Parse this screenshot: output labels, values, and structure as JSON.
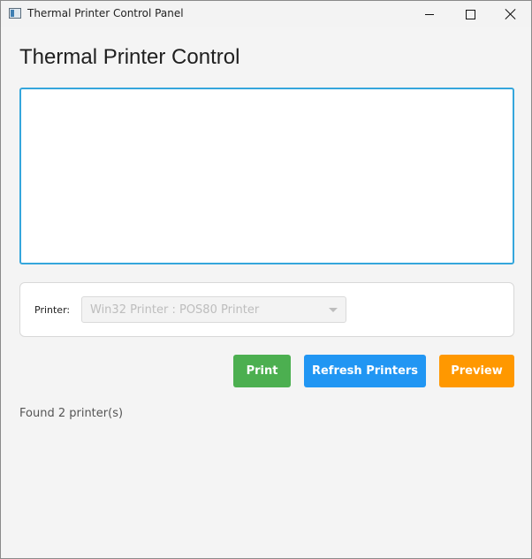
{
  "window": {
    "title": "Thermal Printer Control Panel",
    "icons": [
      "app-icon",
      "minimize-icon",
      "maximize-icon",
      "close-icon"
    ]
  },
  "main": {
    "heading": "Thermal Printer Control",
    "text_area": {
      "value": "",
      "placeholder": ""
    },
    "printer": {
      "label": "Printer:",
      "selected": "Win32 Printer : POS80 Printer",
      "disabled": true
    },
    "buttons": {
      "print": "Print",
      "refresh": "Refresh Printers",
      "preview": "Preview"
    },
    "status": "Found 2 printer(s)"
  },
  "colors": {
    "print": "#4caf50",
    "refresh": "#2196f3",
    "preview": "#ff9800",
    "focus_border": "#35a6dc"
  }
}
